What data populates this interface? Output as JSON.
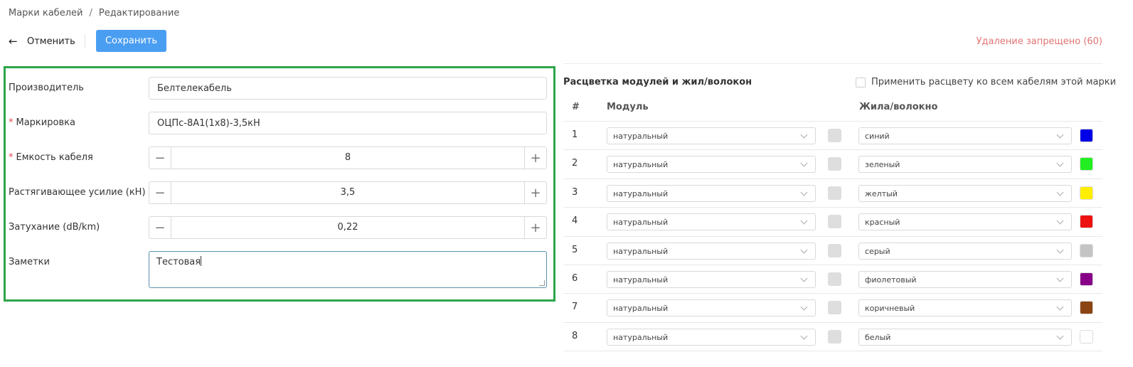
{
  "breadcrumb": {
    "items": [
      "Марки кабелей",
      "Редактирование"
    ],
    "separator": "/"
  },
  "toolbar": {
    "cancel_label": "Отменить",
    "save_label": "Сохранить",
    "delete_status": "Удаление запрещено (60)"
  },
  "form": {
    "manufacturer": {
      "label": "Производитель",
      "value": "Белтелекабель",
      "required": false
    },
    "marking": {
      "label": "Маркировка",
      "value": "ОЦПс-8А1(1х8)-3,5кН",
      "required": true
    },
    "capacity": {
      "label": "Емкость кабеля",
      "value": "8",
      "required": true
    },
    "tensile": {
      "label": "Растягивающее усилие (кН)",
      "value": "3,5",
      "required": false
    },
    "attenuation": {
      "label": "Затухание (dB/km)",
      "value": "0,22",
      "required": false
    },
    "notes": {
      "label": "Заметки",
      "value": "Тестовая",
      "required": false
    },
    "required_mark": "*",
    "minus_glyph": "−",
    "plus_glyph": "+"
  },
  "colors_section": {
    "title": "Расцветка модулей и жил/волокон",
    "apply_all_label": "Применить расцвету ко всем кабелям этой марки",
    "columns": {
      "number": "#",
      "module": "Модуль",
      "fiber": "Жила/волокно"
    },
    "rows": [
      {
        "n": "1",
        "module": "натуральный",
        "fiber": "синий",
        "color": "#0000e6"
      },
      {
        "n": "2",
        "module": "натуральный",
        "fiber": "зеленый",
        "color": "#22ee22"
      },
      {
        "n": "3",
        "module": "натуральный",
        "fiber": "желтый",
        "color": "#ffee00"
      },
      {
        "n": "4",
        "module": "натуральный",
        "fiber": "красный",
        "color": "#ee1111"
      },
      {
        "n": "5",
        "module": "натуральный",
        "fiber": "серый",
        "color": "#c4c4c4"
      },
      {
        "n": "6",
        "module": "натуральный",
        "fiber": "фиолетовый",
        "color": "#880088"
      },
      {
        "n": "7",
        "module": "натуральный",
        "fiber": "коричневый",
        "color": "#8b4513"
      },
      {
        "n": "8",
        "module": "натуральный",
        "fiber": "белый",
        "color": "#ffffff"
      }
    ]
  },
  "theme": {
    "accent": "#4a9ef2",
    "highlight_border": "#2ea64a",
    "danger_text": "#e27575",
    "module_swatch": "#dedede"
  },
  "icons": {
    "back": "arrow-left-icon",
    "dropdown": "chevron-down-icon"
  }
}
